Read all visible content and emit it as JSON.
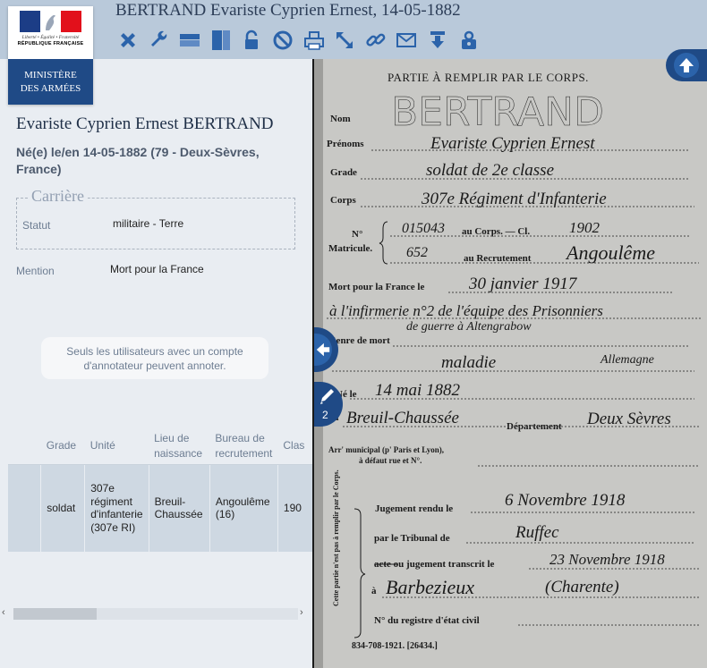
{
  "header": {
    "title": "BERTRAND Evariste Cyprien Ernest, 14-05-1882",
    "toolbar_icons": [
      "close-icon",
      "wrench-icon",
      "horizontal-panel-icon",
      "vertical-panel-icon",
      "lock-icon",
      "forbidden-icon",
      "print-icon",
      "expand-icon",
      "link-icon",
      "mail-icon",
      "download-icon",
      "help-lock-icon"
    ]
  },
  "logo": {
    "motto": "Liberté • Égalité • Fraternité",
    "republic": "RÉPUBLIQUE FRANÇAISE",
    "ministry_line1": "MINISTÈRE",
    "ministry_line2": "DES ARMÉES"
  },
  "person": {
    "name": "Evariste Cyprien Ernest BERTRAND",
    "birth": "Né(e) le/en 14-05-1882 (79 - Deux-Sèvres, France)"
  },
  "career": {
    "legend": "Carrière",
    "statut_label": "Statut",
    "statut_value": "militaire - Terre"
  },
  "mention": {
    "label": "Mention",
    "value": "Mort pour la France"
  },
  "annotation_note": "Seuls les utilisateurs avec un compte d'annotateur peuvent annoter.",
  "table": {
    "headers": [
      "",
      "Grade",
      "Unité",
      "Lieu de naissance",
      "Bureau de recrutement",
      "Clas"
    ],
    "row": [
      "",
      "soldat",
      "307e régiment d'infanterie (307e RI)",
      "Breuil-Chaussée",
      "Angoulême (16)",
      "190"
    ]
  },
  "scrollbar": {
    "left": "‹",
    "right": "›"
  },
  "document": {
    "heading": "PARTIE À REMPLIR PAR LE CORPS.",
    "nom_label": "Nom",
    "nom": "BERTRAND",
    "prenoms_label": "Prénoms",
    "prenoms": "Evariste Cyprien Ernest",
    "grade_label": "Grade",
    "grade": "soldat de 2e classe",
    "corps_label": "Corps",
    "corps": "307e Régiment d'Infanterie",
    "matricule_label": "Matricule.",
    "no_label": "N°",
    "au_corps": "au Corps. —  Cl.",
    "matricule_corps": "015043",
    "classe": "1902",
    "au_recrutement": "au Recrutement",
    "matricule_recr": "652",
    "recrutement": "Angoulême",
    "mort_label": "Mort pour la France le",
    "date_deces": "30 janvier 1917",
    "lieu_deces_1": "à l'infirmerie n°2 de l'équipe des Prisonniers",
    "lieu_deces_2": "de guerre à Altengrabow",
    "genre_label": "Genre de mort",
    "genre_mort": "maladie",
    "pays": "Allemagne",
    "ne_label": "Né le",
    "date_naissance": "14 mai 1882",
    "a_label": "à",
    "lieu_naissance": "Breuil-Chaussée",
    "departement_label": "Département",
    "departement": "Deux Sèvres",
    "arr_label": "Arr' municipal (p' Paris et Lyon),",
    "arr_label_2": "à défaut rue et N°.",
    "side_note": "Cette partie n'est pas à remplir par le Corps.",
    "jugement_label": "Jugement rendu le",
    "jugement_date": "6 Novembre 1918",
    "tribunal_label": "par le Tribunal de",
    "tribunal": "Ruffec",
    "transcrit_label": "acte ou jugement transcrit le",
    "transcrit_date": "23 Novembre 1918",
    "a2_label": "à",
    "transcrit_lieu": "Barbezieux",
    "transcrit_dept": "(Charente)",
    "registre_label": "N° du registre d'état civil",
    "imprimeur": "834-708-1921. [26434.]"
  },
  "annotation_count": "2"
}
